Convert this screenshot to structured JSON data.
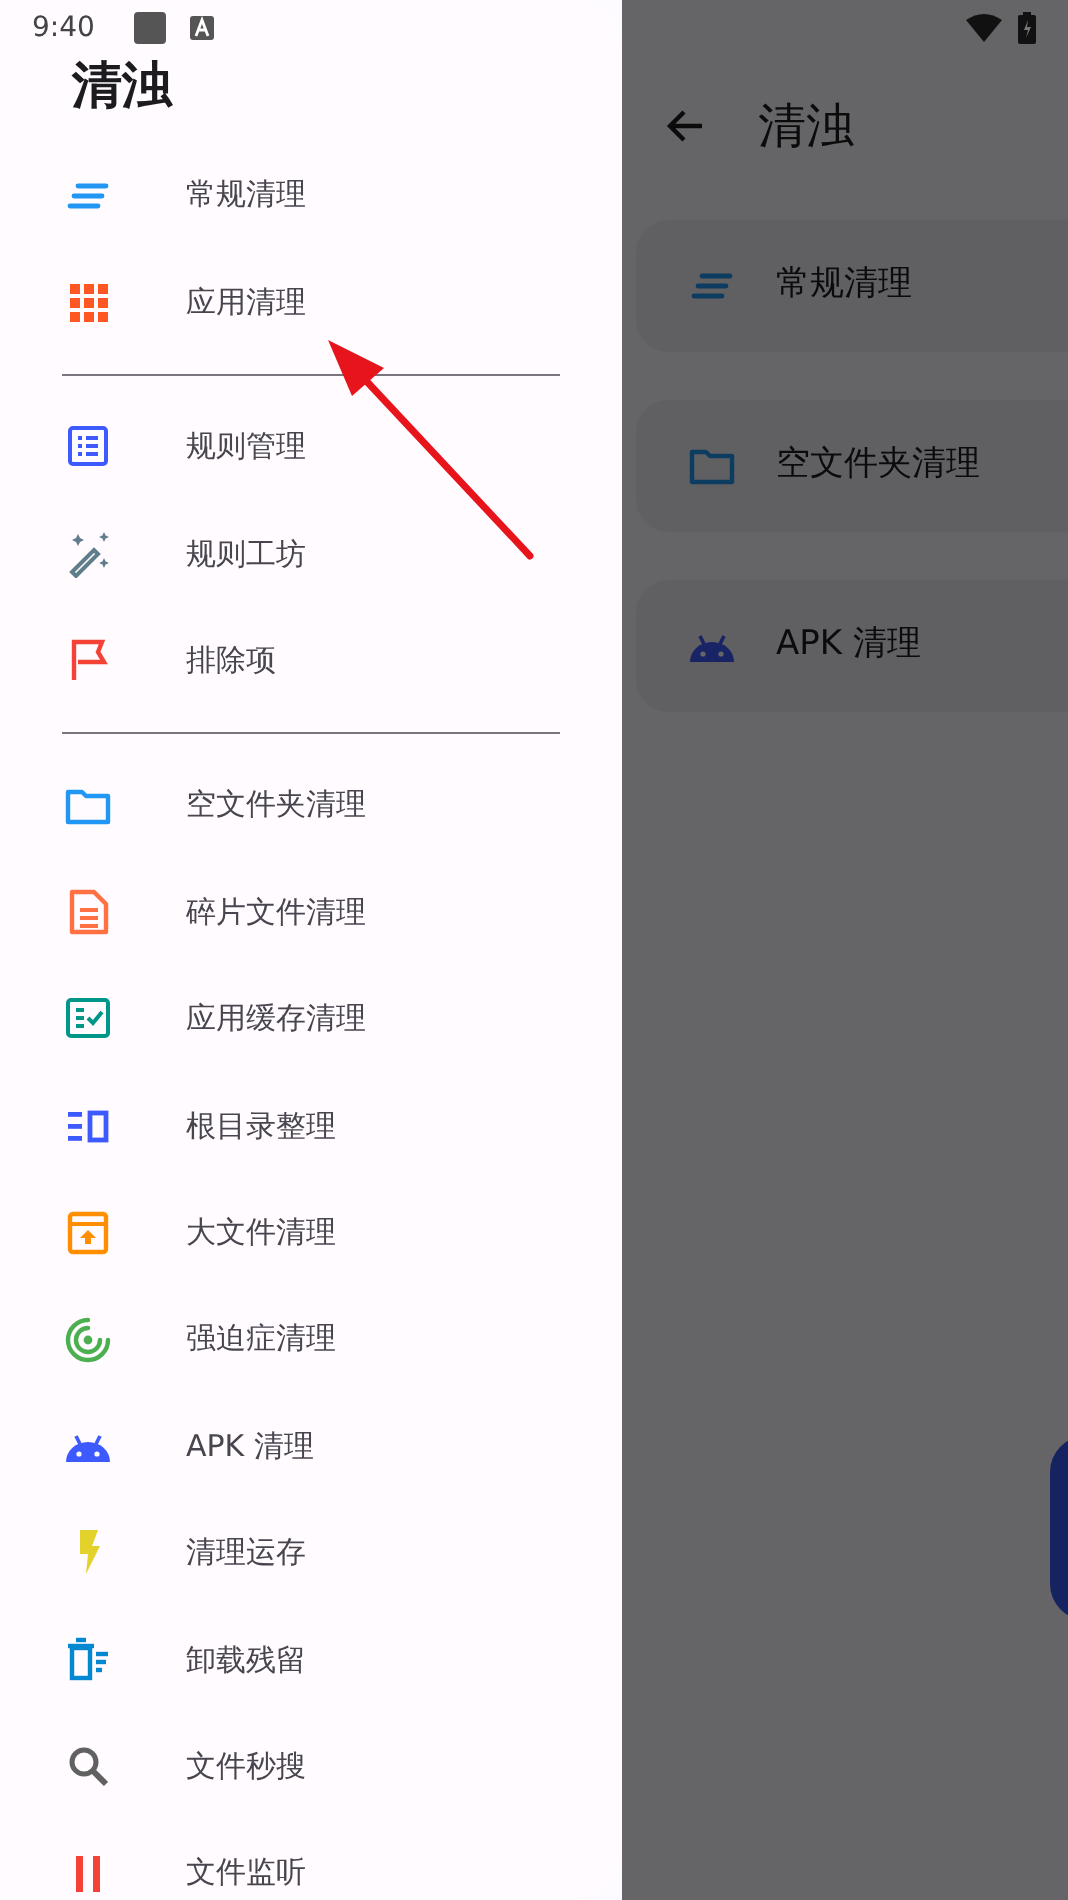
{
  "status_bar": {
    "time": "9:40"
  },
  "drawer": {
    "title": "清浊",
    "sections": [
      {
        "items": [
          {
            "label": "常规清理",
            "kind": "lines"
          },
          {
            "label": "应用清理",
            "kind": "grid"
          }
        ]
      },
      {
        "items": [
          {
            "label": "规则管理",
            "kind": "list"
          },
          {
            "label": "规则工坊",
            "kind": "wand"
          },
          {
            "label": "排除项",
            "kind": "flag"
          }
        ]
      },
      {
        "items": [
          {
            "label": "空文件夹清理",
            "kind": "folder"
          },
          {
            "label": "碎片文件清理",
            "kind": "doc"
          },
          {
            "label": "应用缓存清理",
            "kind": "checklist"
          },
          {
            "label": "根目录整理",
            "kind": "columns"
          },
          {
            "label": "大文件清理",
            "kind": "archive"
          },
          {
            "label": "强迫症清理",
            "kind": "radar"
          },
          {
            "label": "APK 清理",
            "kind": "android"
          },
          {
            "label": "清理运存",
            "kind": "bolt"
          },
          {
            "label": "卸载残留",
            "kind": "trash"
          },
          {
            "label": "文件秒搜",
            "kind": "search"
          },
          {
            "label": "文件监听",
            "kind": "pause"
          }
        ]
      }
    ]
  },
  "main": {
    "title": "清浊",
    "cards": [
      {
        "label": "常规清理",
        "kind": "lines"
      },
      {
        "label": "空文件夹清理",
        "kind": "folder"
      },
      {
        "label": "APK 清理",
        "kind": "android"
      }
    ]
  }
}
